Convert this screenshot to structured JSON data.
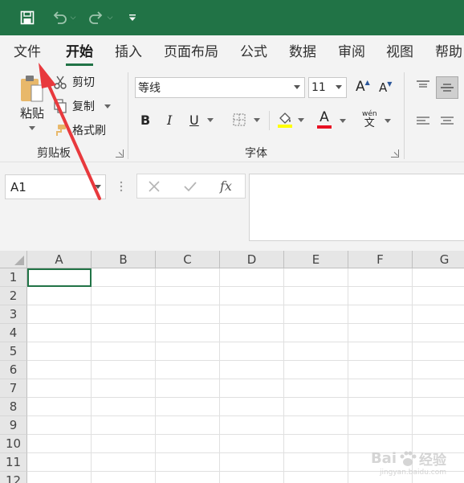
{
  "quick_access": {
    "save_icon": "save-icon",
    "undo_icon": "undo-icon",
    "redo_icon": "redo-icon",
    "customize_icon": "customize-qat-icon"
  },
  "tabs": [
    "文件",
    "开始",
    "插入",
    "页面布局",
    "公式",
    "数据",
    "审阅",
    "视图",
    "帮助"
  ],
  "active_tab": "开始",
  "clipboard": {
    "paste": "粘贴",
    "cut": "剪切",
    "copy": "复制",
    "format_painter": "格式刷",
    "group_label": "剪贴板"
  },
  "font": {
    "font_name": "等线",
    "font_size": "11",
    "bold": "B",
    "italic": "I",
    "underline": "U",
    "font_color_letter": "A",
    "phonetic_top": "wén",
    "phonetic_bottom": "文",
    "grow_letter": "A",
    "shrink_letter": "A",
    "group_label": "字体"
  },
  "formula_bar": {
    "name_box": "A1",
    "fx_label": "fx"
  },
  "grid": {
    "columns": [
      "A",
      "B",
      "C",
      "D",
      "E",
      "F",
      "G"
    ],
    "rows": [
      "1",
      "2",
      "3",
      "4",
      "5",
      "6",
      "7",
      "8",
      "9",
      "10",
      "11",
      "12"
    ],
    "selected_cell": "A1"
  },
  "colors": {
    "brand": "#217346",
    "highlight_yellow": "#ffff00",
    "font_red": "#e81123",
    "annotation_arrow": "#e8393d"
  },
  "watermark": {
    "brand": "Bai",
    "brand_cn": "经验",
    "url": "jingyan.baidu.com"
  }
}
